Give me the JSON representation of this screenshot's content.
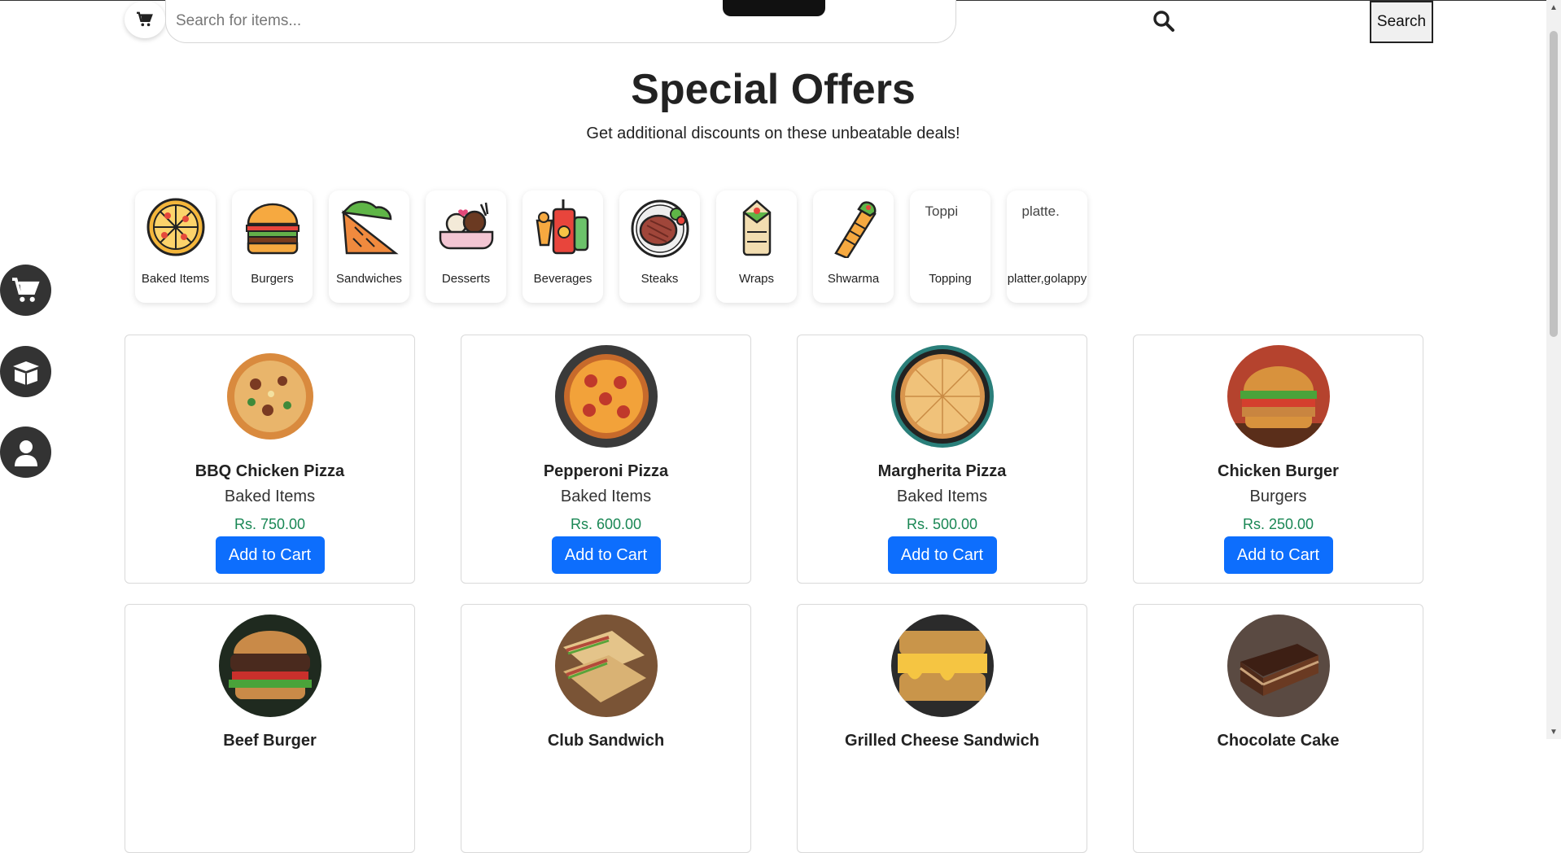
{
  "search": {
    "placeholder": "Search for items...",
    "button_label": "Search"
  },
  "header": {
    "title": "Special Offers",
    "subtitle": "Get additional discounts on these unbeatable deals!"
  },
  "categories": [
    {
      "label": "Baked Items",
      "icon": "pizza-icon"
    },
    {
      "label": "Burgers",
      "icon": "burger-icon"
    },
    {
      "label": "Sandwiches",
      "icon": "sandwich-icon"
    },
    {
      "label": "Desserts",
      "icon": "dessert-icon"
    },
    {
      "label": "Beverages",
      "icon": "beverage-icon"
    },
    {
      "label": "Steaks",
      "icon": "steak-icon"
    },
    {
      "label": "Wraps",
      "icon": "wrap-icon"
    },
    {
      "label": "Shwarma",
      "icon": "shwarma-icon"
    },
    {
      "label": "Topping",
      "icon": "broken-image",
      "alt": "Toppi"
    },
    {
      "label": "platter,golappy",
      "icon": "broken-image",
      "alt": "platte."
    }
  ],
  "products": [
    {
      "name": "BBQ Chicken Pizza",
      "category": "Baked Items",
      "price": "Rs. 750.00",
      "button": "Add to Cart"
    },
    {
      "name": "Pepperoni Pizza",
      "category": "Baked Items",
      "price": "Rs. 600.00",
      "button": "Add to Cart"
    },
    {
      "name": "Margherita Pizza",
      "category": "Baked Items",
      "price": "Rs. 500.00",
      "button": "Add to Cart"
    },
    {
      "name": "Chicken Burger",
      "category": "Burgers",
      "price": "Rs. 250.00",
      "button": "Add to Cart"
    },
    {
      "name": "Beef Burger"
    },
    {
      "name": "Club Sandwich"
    },
    {
      "name": "Grilled Cheese Sandwich"
    },
    {
      "name": "Chocolate Cake"
    }
  ],
  "colors": {
    "accent": "#0d6efd",
    "price": "#198754",
    "side_button": "#333333"
  }
}
